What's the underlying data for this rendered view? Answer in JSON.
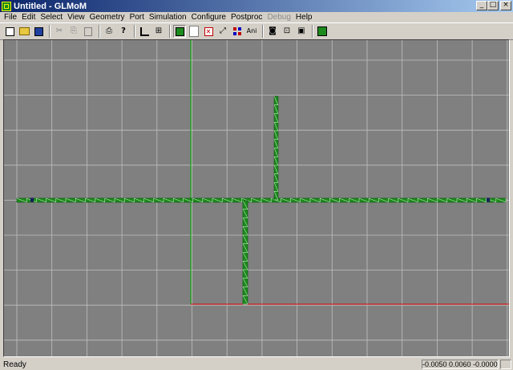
{
  "window": {
    "title": "Untitled - GLMoM",
    "minimize_glyph": "_",
    "maximize_glyph": "□",
    "close_glyph": "×"
  },
  "menu": [
    {
      "label": "File",
      "enabled": true
    },
    {
      "label": "Edit",
      "enabled": true
    },
    {
      "label": "Select",
      "enabled": true
    },
    {
      "label": "View",
      "enabled": true
    },
    {
      "label": "Geometry",
      "enabled": true
    },
    {
      "label": "Port",
      "enabled": true
    },
    {
      "label": "Simulation",
      "enabled": true
    },
    {
      "label": "Configure",
      "enabled": true
    },
    {
      "label": "Postproc",
      "enabled": true
    },
    {
      "label": "Debug",
      "enabled": false
    },
    {
      "label": "Help",
      "enabled": true
    }
  ],
  "toolbar": {
    "new_icon": "new-file-icon",
    "open_icon": "open-folder-icon",
    "save_icon": "save-icon",
    "cut_glyph": "✂",
    "copy_glyph": "⎘",
    "paste_glyph": "📋",
    "print_glyph": "⎙",
    "help_glyph": "?",
    "ruler_glyph": "📐",
    "measure_glyph": "⊞",
    "delete_glyph": "✕",
    "fit_glyph": "⤢",
    "ani_label": "Ani",
    "camera_glyph": "◙",
    "zoom_fit_glyph": "⊡",
    "export_glyph": "▣",
    "mesh_glyph": "▦"
  },
  "status": {
    "message": "Ready",
    "coords": "-0.0050  0.0060 -0.0000"
  },
  "colors": {
    "viewport_bg": "#808080",
    "grid_line": "#c0c0c0",
    "y_axis": "#00b000",
    "x_axis": "#e00000",
    "mesh_fill": "#1d8a1d",
    "mesh_line": "#e8ffe8"
  }
}
